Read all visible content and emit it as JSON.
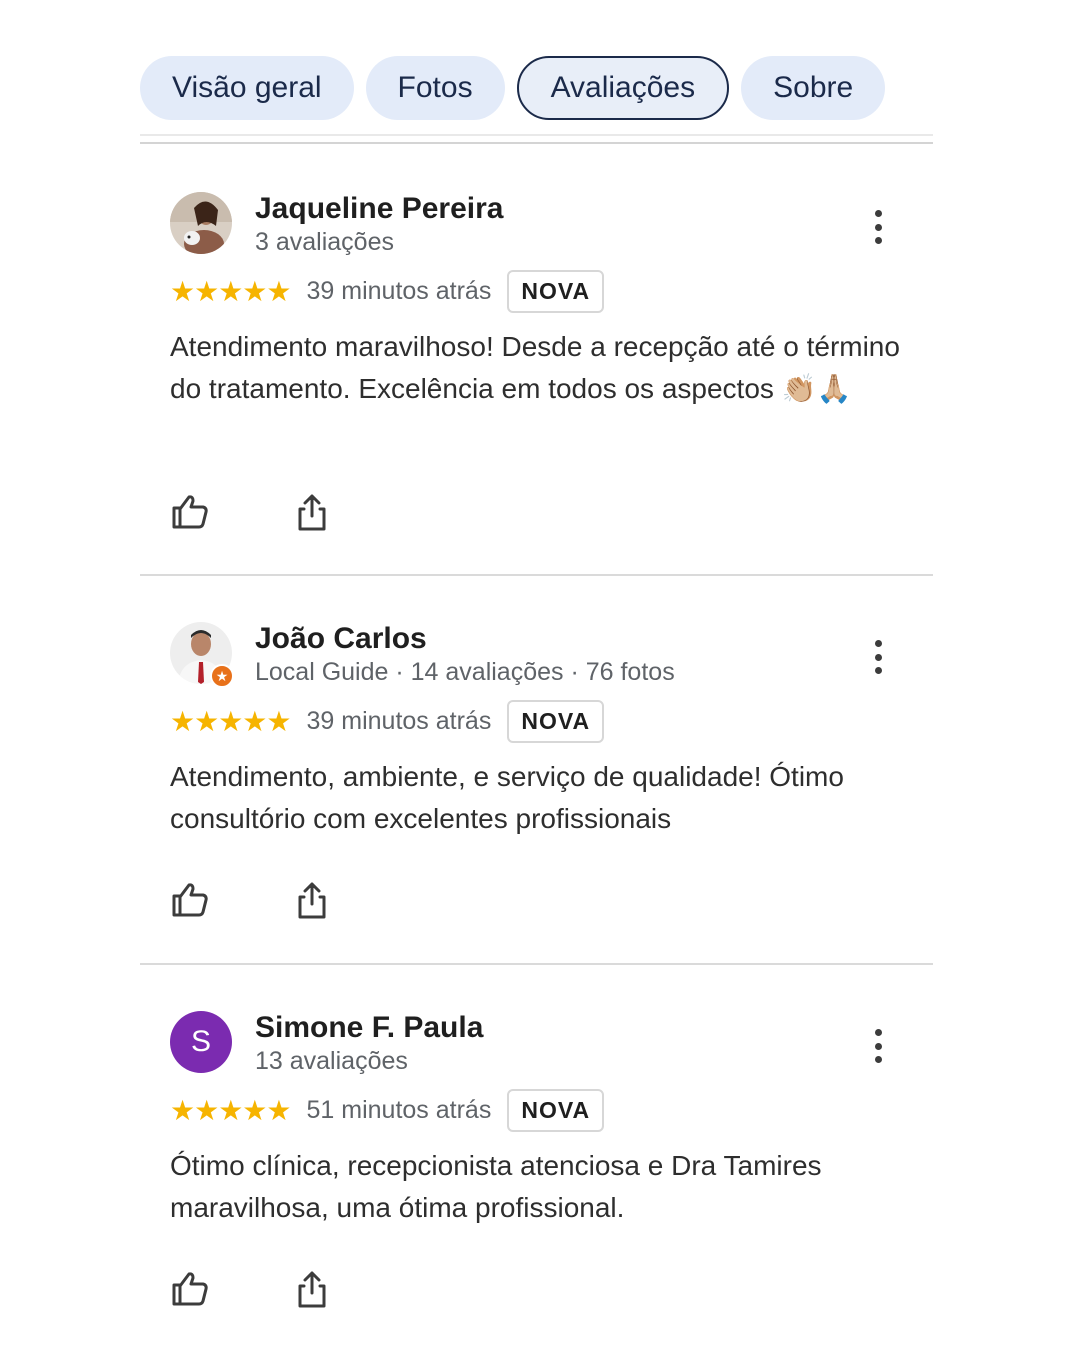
{
  "tabs": [
    {
      "label": "Visão geral"
    },
    {
      "label": "Fotos"
    },
    {
      "label": "Avaliações",
      "active": true
    },
    {
      "label": "Sobre"
    }
  ],
  "reviews": [
    {
      "name": "Jaqueline Pereira",
      "meta": "3 avaliações",
      "stars": "★★★★★",
      "time": "39 minutos atrás",
      "badge": "NOVA",
      "text": "Atendimento maravilhoso! Desde a recepção até o término do tratamento. Excelência em todos os aspectos 👏🏼🙏🏼"
    },
    {
      "name": "João Carlos",
      "meta": "Local Guide · 14 avaliações · 76 fotos",
      "stars": "★★★★★",
      "time": "39 minutos atrás",
      "badge": "NOVA",
      "text": "Atendimento, ambiente, e serviço de qualidade! Ótimo consultório com excelentes profissionais"
    },
    {
      "name": "Simone F. Paula",
      "avatar_letter": "S",
      "meta": "13 avaliações",
      "stars": "★★★★★",
      "time": "51 minutos atrás",
      "badge": "NOVA",
      "text": "Ótimo clínica, recepcionista atenciosa e Dra Tamires maravilhosa, uma ótima profissional."
    }
  ],
  "colors": {
    "star": "#f6b400",
    "tab_bg": "#e3ebf9",
    "tab_text": "#1b2a4a",
    "avatar_purple": "#7b2bb0",
    "local_guide_badge": "#e8711a"
  },
  "icons": {
    "like": "thumbs-up-icon",
    "share": "share-icon",
    "more": "more-vert-icon"
  }
}
